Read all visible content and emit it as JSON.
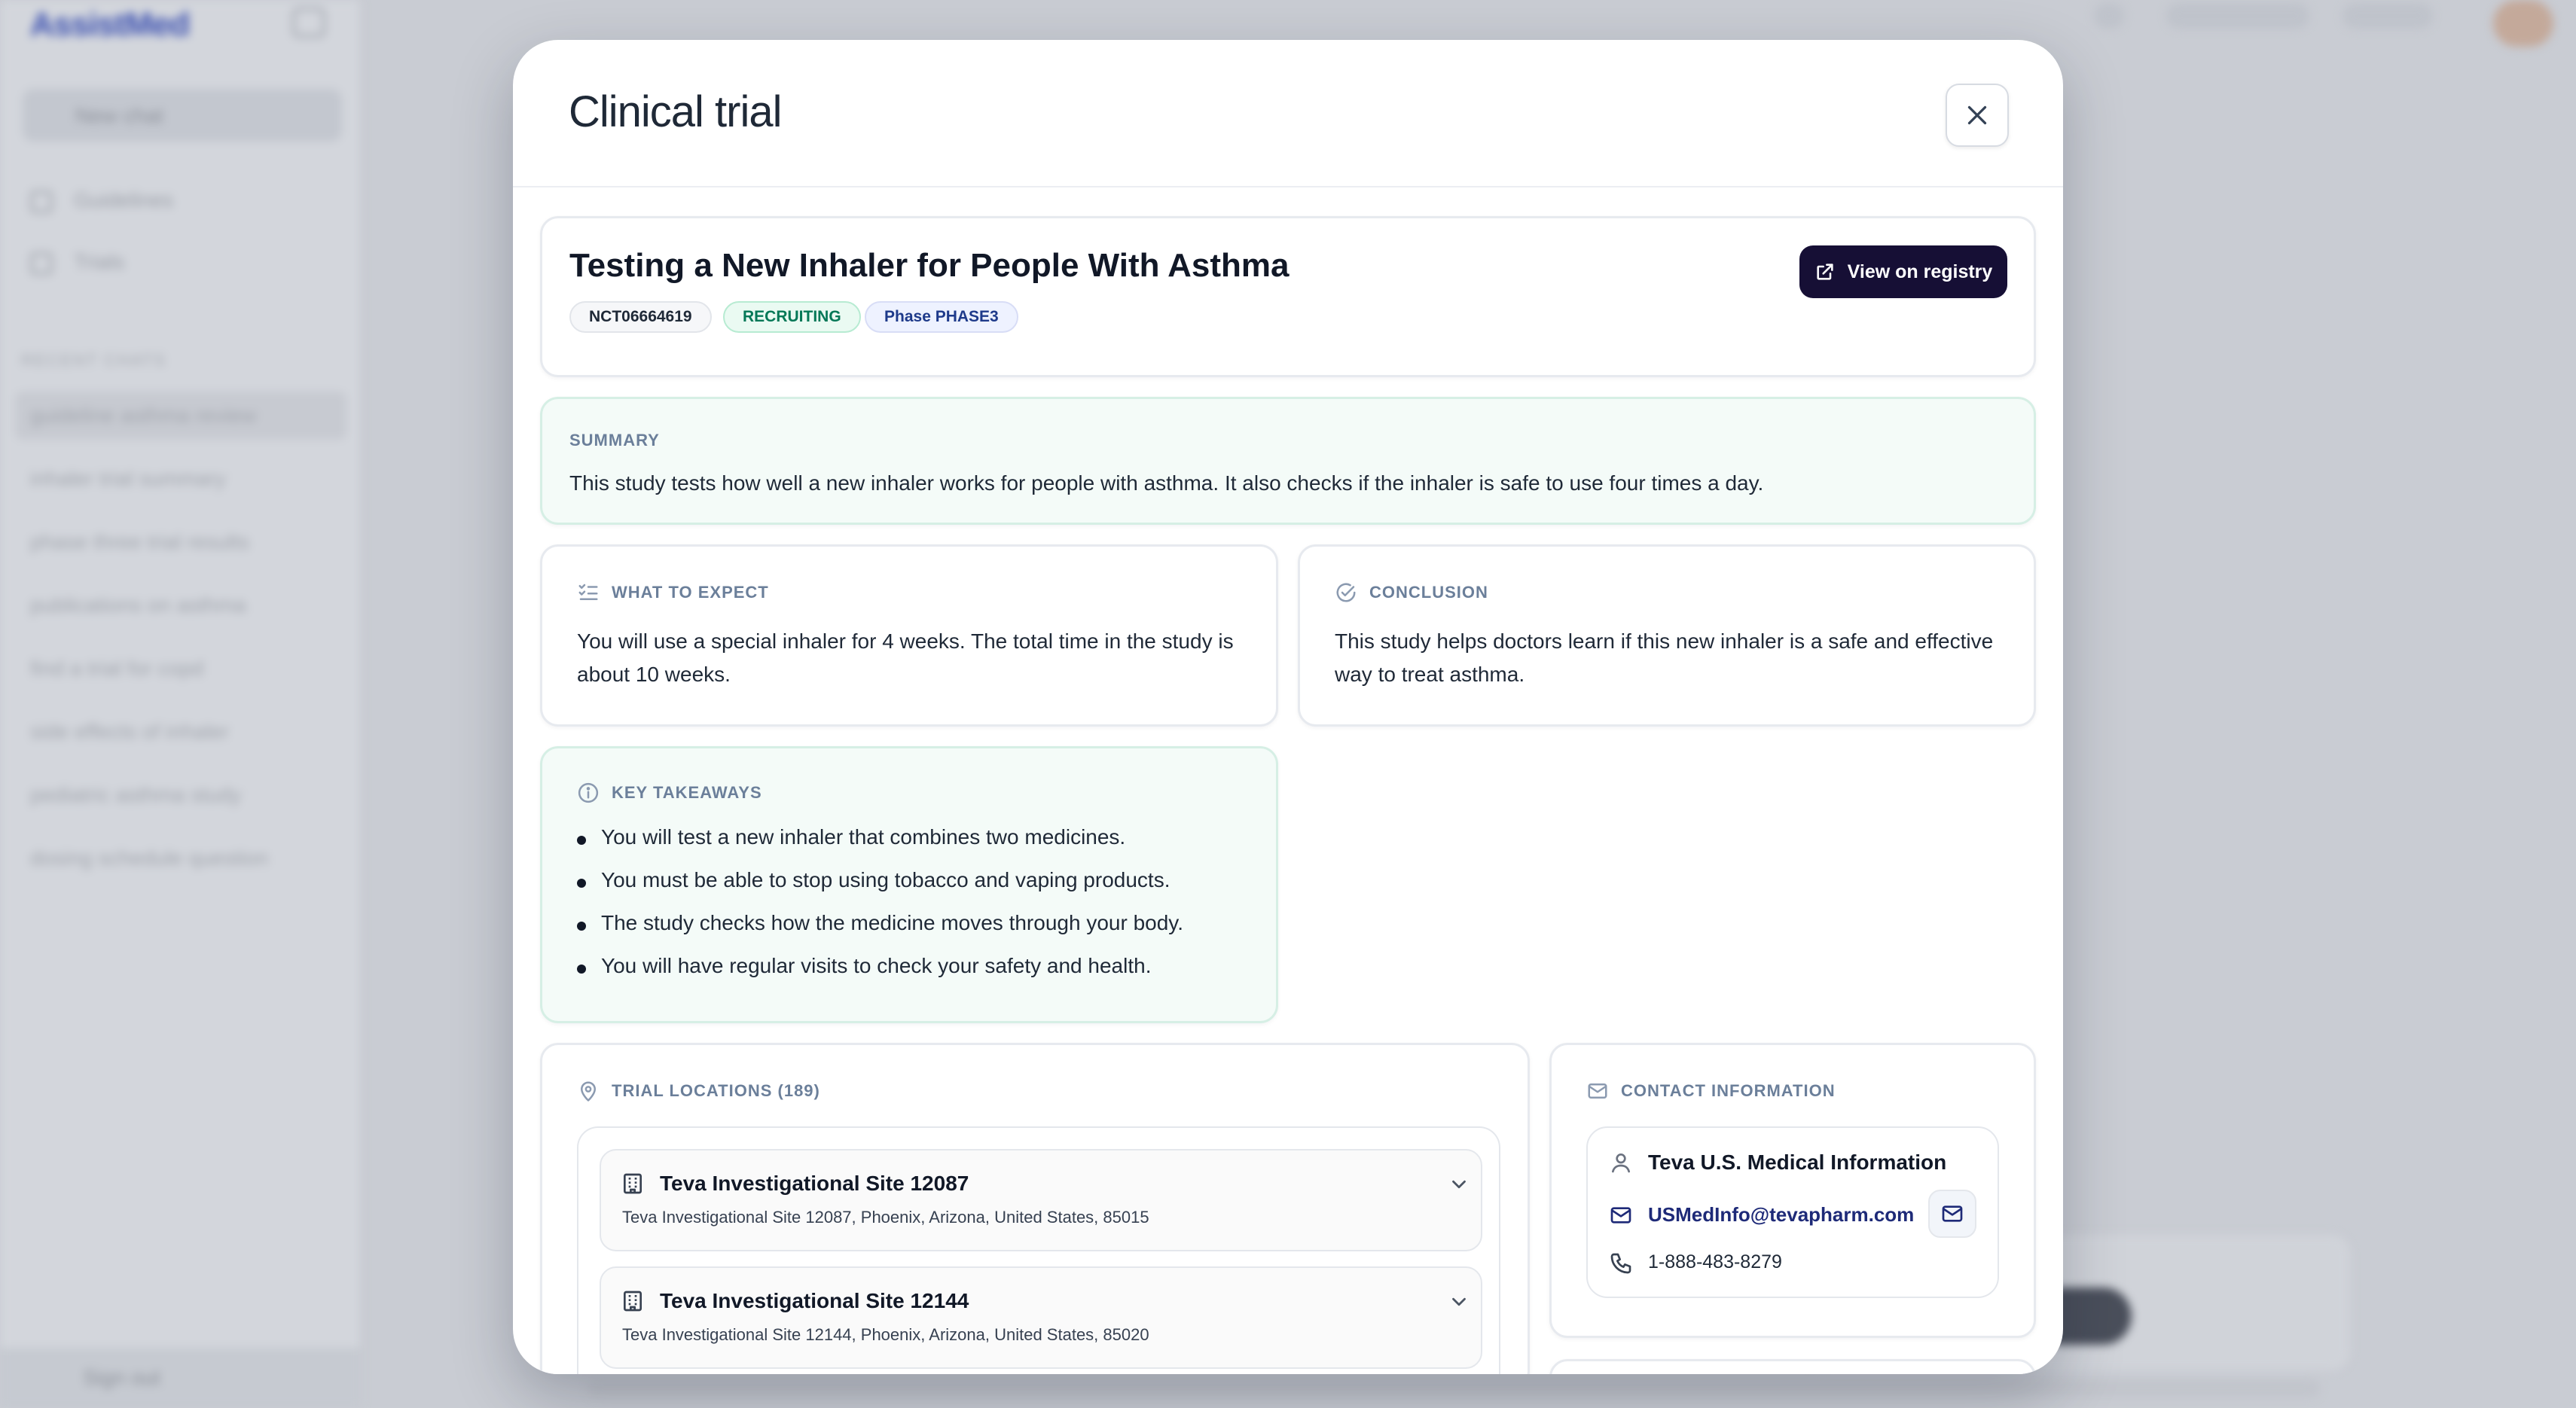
{
  "background": {
    "logo": "AssistMed",
    "new_chat": "New chat",
    "nav": [
      "Guidelines",
      "Trials"
    ],
    "section": "RECENT CHATS",
    "history": [
      "guideline asthma review",
      "inhaler trial summary",
      "phase three trial results",
      "publications on asthma",
      "find a trial for copd",
      "side effects of inhaler",
      "pediatric asthma study",
      "dosing schedule question"
    ],
    "footer": "Sign out"
  },
  "modal": {
    "title": "Clinical trial",
    "close_icon": "close-icon",
    "trial": {
      "title": "Testing a New Inhaler for People With Asthma",
      "nct_id": "NCT06664619",
      "status": "RECRUITING",
      "phase": "Phase PHASE3",
      "registry_button": "View on registry"
    },
    "summary": {
      "label": "SUMMARY",
      "text": "This study tests how well a new inhaler works for people with asthma. It also checks if the inhaler is safe to use four times a day."
    },
    "what_to_expect": {
      "label": "WHAT TO EXPECT",
      "line1": "You will use a special inhaler for 4 weeks. The total time in the study is",
      "line2": "about 10 weeks."
    },
    "conclusion": {
      "label": "CONCLUSION",
      "line1": "This study helps doctors learn if this new inhaler is a safe and effective",
      "line2": "way to treat asthma."
    },
    "key_takeaways": {
      "label": "KEY TAKEAWAYS",
      "items": [
        "You will test a new inhaler that combines two medicines.",
        "You must be able to stop using tobacco and vaping products.",
        "The study checks how the medicine moves through your body.",
        "You will have regular visits to check your safety and health."
      ]
    },
    "locations": {
      "label": "TRIAL LOCATIONS (189)",
      "items": [
        {
          "name": "Teva Investigational Site 12087",
          "address": "Teva Investigational Site 12087, Phoenix, Arizona, United States, 85015"
        },
        {
          "name": "Teva Investigational Site 12144",
          "address": "Teva Investigational Site 12144, Phoenix, Arizona, United States, 85020"
        }
      ]
    },
    "contact": {
      "label": "CONTACT INFORMATION",
      "name": "Teva U.S. Medical Information",
      "email": "USMedInfo@tevapharm.com",
      "phone": "1-888-483-8279"
    }
  },
  "colors": {
    "primary_dark": "#160f35",
    "status_green": "#047857",
    "label_gray": "#6b7f9a",
    "tint_bg": "#f4fbf8"
  }
}
